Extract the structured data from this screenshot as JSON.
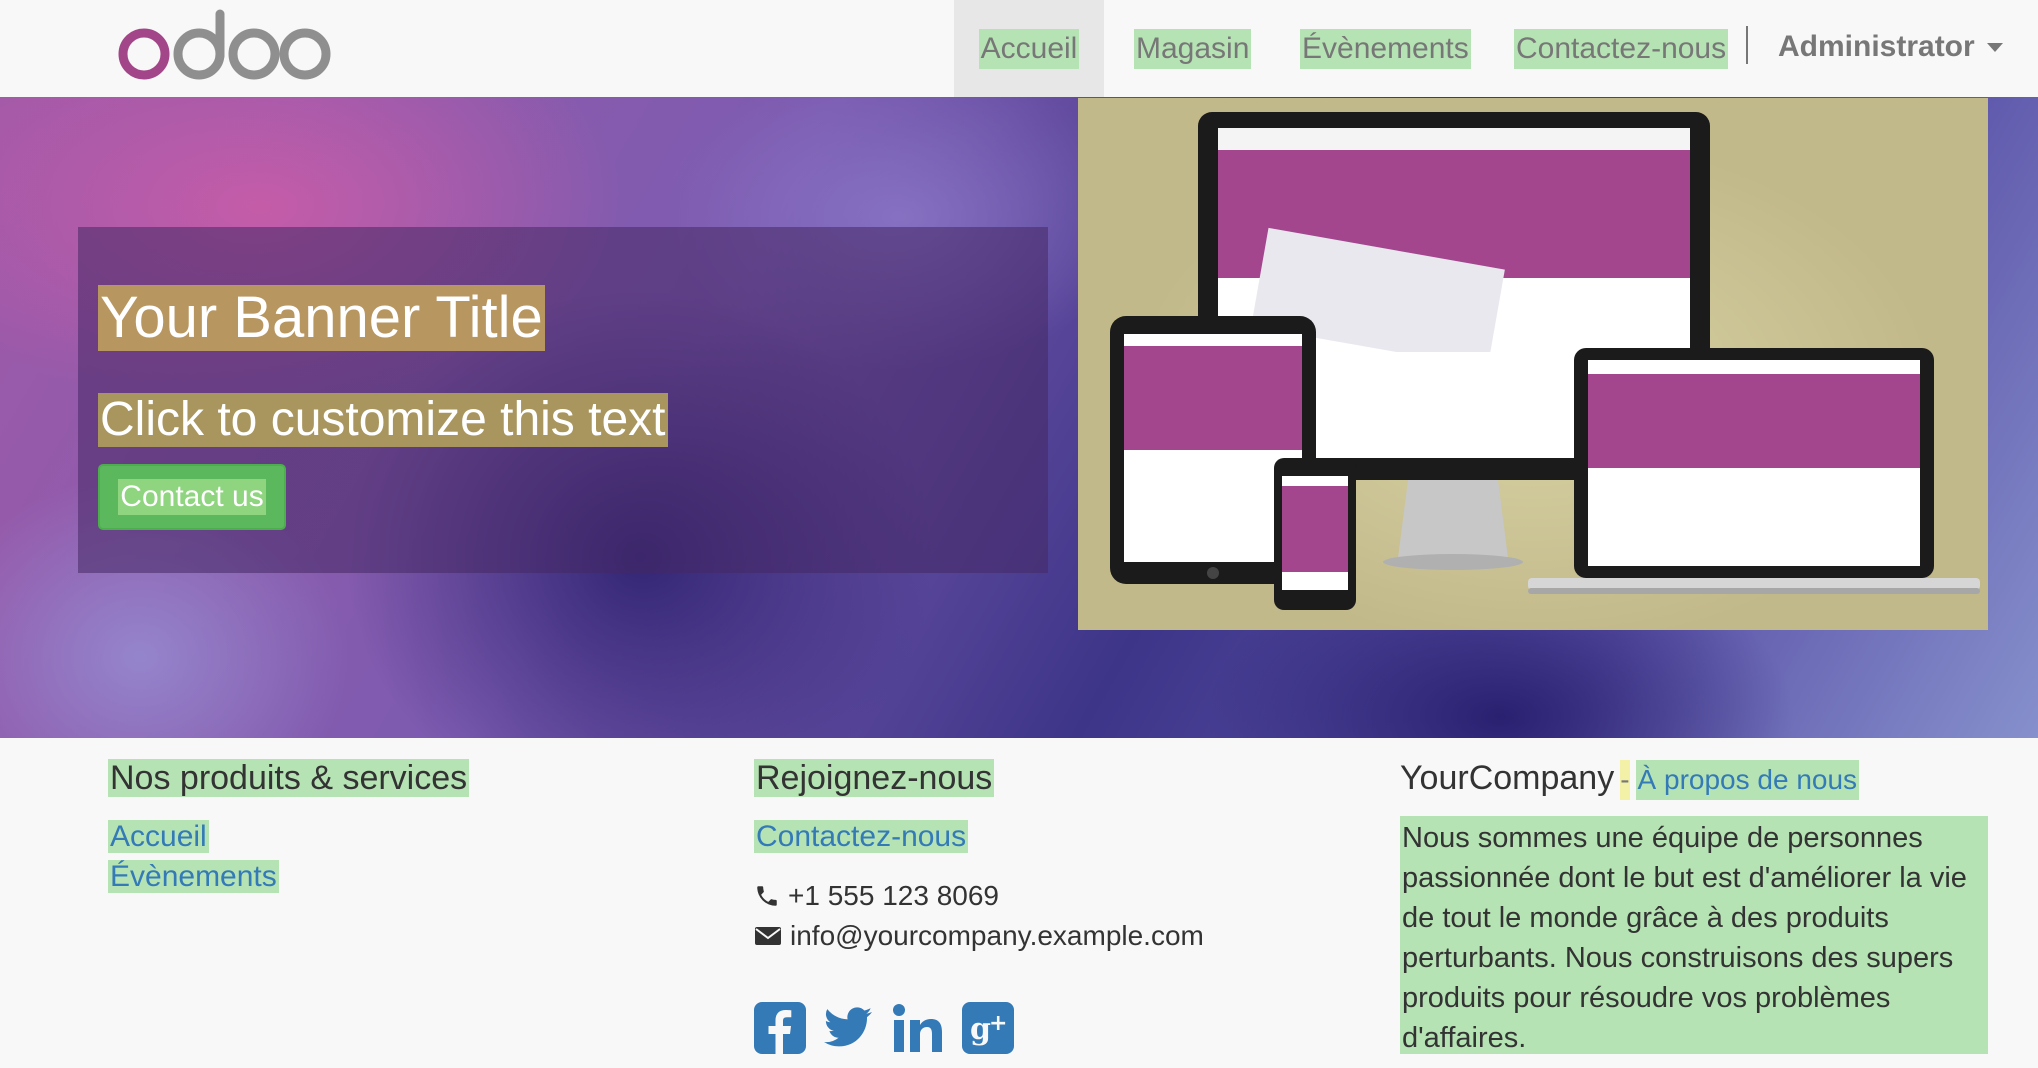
{
  "nav": {
    "items": [
      {
        "label": "Accueil",
        "active": true
      },
      {
        "label": "Magasin",
        "active": false
      },
      {
        "label": "Évènements",
        "active": false
      },
      {
        "label": "Contactez-nous",
        "active": false
      }
    ],
    "user": "Administrator"
  },
  "logo": {
    "text": "odoo"
  },
  "banner": {
    "title": "Your Banner Title",
    "subtitle": "Click to customize this text",
    "button": "Contact us"
  },
  "footer": {
    "products": {
      "title": "Nos produits & services",
      "links": [
        "Accueil",
        "Évènements"
      ]
    },
    "join": {
      "title": "Rejoignez-nous",
      "contact_link": "Contactez-nous",
      "phone": "+1 555 123 8069",
      "email": "info@yourcompany.example.com",
      "social": [
        "facebook-icon",
        "twitter-icon",
        "linkedin-icon",
        "google-plus-icon"
      ]
    },
    "company": {
      "name": "YourCompany",
      "separator": "-",
      "about_link": "À propos de nous",
      "description": "Nous sommes une équipe de personnes passionnée dont le but est d'améliorer la vie de tout le monde grâce à des produits perturbants. Nous construisons des supers produits pour résoudre vos problèmes d'affaires."
    }
  },
  "colors": {
    "accent_highlight": "#b6e3b4",
    "link": "#337ab7",
    "button": "#5cb85c",
    "odoo_purple": "#a24689",
    "odoo_grey": "#8f8f8f"
  }
}
